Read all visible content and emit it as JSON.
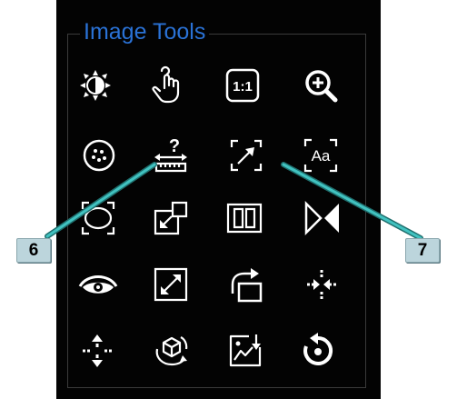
{
  "panel": {
    "title": "Image Tools"
  },
  "tools": [
    {
      "icon": "brightness-contrast-icon"
    },
    {
      "icon": "pan-hand-icon"
    },
    {
      "icon": "one-to-one-icon",
      "label": "1:1"
    },
    {
      "icon": "zoom-in-icon"
    },
    {
      "icon": "roi-icon"
    },
    {
      "icon": "calibration-ruler-icon",
      "label": "?"
    },
    {
      "icon": "line-measure-icon"
    },
    {
      "icon": "annotation-text-icon",
      "label": "Aa"
    },
    {
      "icon": "ellipse-roi-icon"
    },
    {
      "icon": "reduce-window-icon"
    },
    {
      "icon": "split-view-icon"
    },
    {
      "icon": "flip-horizontal-icon"
    },
    {
      "icon": "show-hide-icon"
    },
    {
      "icon": "fit-screen-icon"
    },
    {
      "icon": "rotate-frame-icon"
    },
    {
      "icon": "move-horizontal-icon"
    },
    {
      "icon": "move-vertical-icon"
    },
    {
      "icon": "3d-rotate-icon"
    },
    {
      "icon": "export-image-icon"
    },
    {
      "icon": "reset-icon"
    }
  ],
  "callouts": [
    {
      "label": "6"
    },
    {
      "label": "7"
    }
  ],
  "colors": {
    "panel_bg": "#030303",
    "title_blue": "#2a72d6",
    "icon_white": "#ffffff",
    "leader_teal": "#2fa8a8",
    "badge_fill": "#bcd5dc"
  }
}
